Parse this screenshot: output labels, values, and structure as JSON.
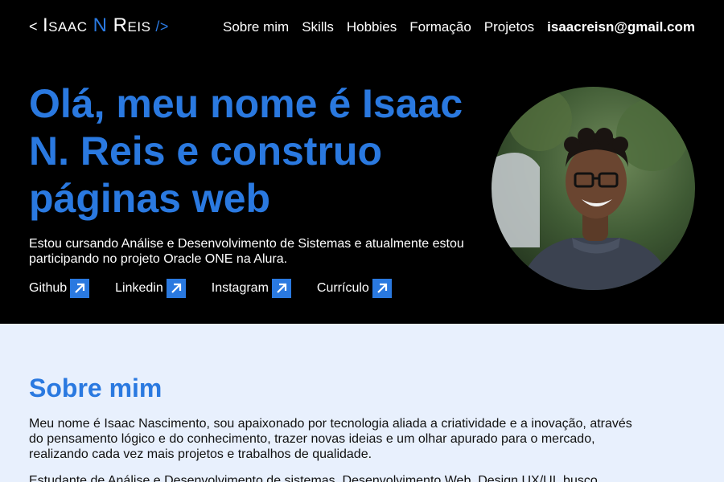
{
  "header": {
    "logo": {
      "open": "<",
      "name_first": "Isaac",
      "name_mid": "N",
      "name_last": "Reis",
      "close": "/>"
    },
    "nav": [
      {
        "label": "Sobre mim"
      },
      {
        "label": "Skills"
      },
      {
        "label": "Hobbies"
      },
      {
        "label": "Formação"
      },
      {
        "label": "Projetos"
      }
    ],
    "email": "isaacreisn@gmail.com"
  },
  "hero": {
    "title": "Olá, meu nome é Isaac N. Reis e construo páginas web",
    "intro": "Estou cursando Análise e Desenvolvimento de Sistemas e atualmente estou participando no projeto Oracle ONE na Alura.",
    "links": [
      {
        "label": "Github",
        "icon": "external-link-icon"
      },
      {
        "label": "Linkedin",
        "icon": "external-link-icon"
      },
      {
        "label": "Instagram",
        "icon": "external-link-icon"
      },
      {
        "label": "Currículo",
        "icon": "external-link-icon"
      }
    ]
  },
  "about": {
    "title": "Sobre mim",
    "paragraph1": "Meu nome é Isaac Nascimento, sou apaixonado por tecnologia aliada a criatividade e a inovação, através do pensamento lógico e do conhecimento, trazer novas ideias e um olhar apurado para o mercado, realizando cada vez mais projetos e trabalhos de qualidade.",
    "paragraph2": "Estudante de Análise e Desenvolvimento de sistemas, Desenvolvimento Web, Design UX/UI, busco"
  },
  "colors": {
    "accent": "#2a79e0",
    "hero_bg": "#000000",
    "about_bg": "#e8f0fd"
  }
}
